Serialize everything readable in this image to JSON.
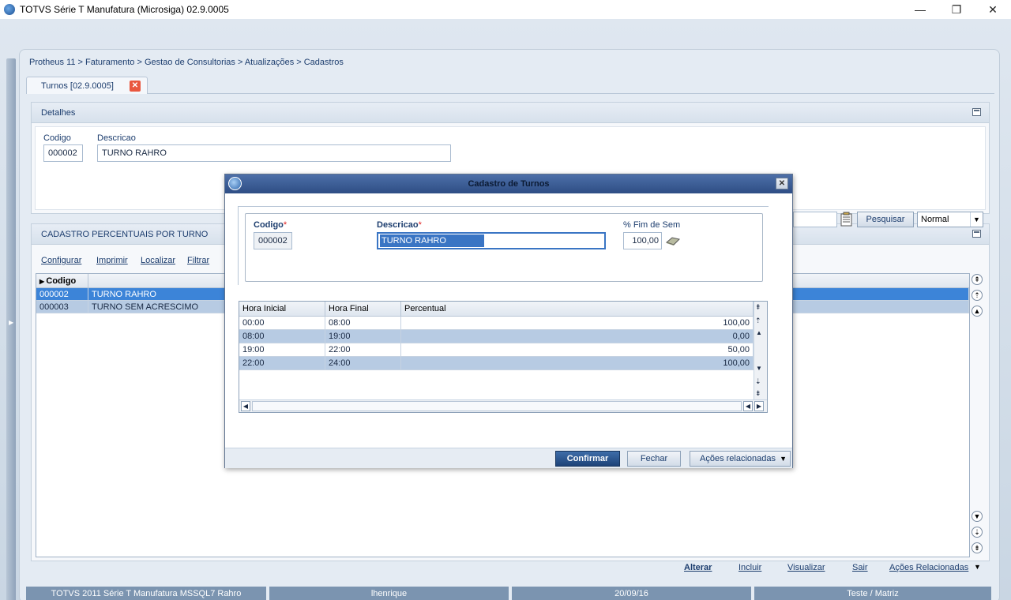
{
  "window": {
    "title": "TOTVS Série T Manufatura (Microsiga) 02.9.0005",
    "minimize": "—",
    "maximize": "❐",
    "close": "✕"
  },
  "breadcrumb": "Protheus 11 > Faturamento > Gestao de Consultorias > Atualizações > Cadastros",
  "tab": {
    "label": "Turnos [02.9.0005]",
    "close": "✕"
  },
  "details": {
    "title": "Detalhes",
    "codigo_label": "Codigo",
    "codigo_value": "000002",
    "descricao_label": "Descricao",
    "descricao_value": "TURNO RAHRO"
  },
  "cadastro": {
    "title": "CADASTRO PERCENTUAIS POR TURNO",
    "toolbar": [
      "Configurar",
      "Imprimir",
      "Localizar",
      "Filtrar"
    ],
    "pesquisar": "Pesquisar",
    "index_select": "Normal",
    "header_col": "Codigo",
    "rows": [
      {
        "codigo": "000002",
        "descricao": "TURNO RAHRO"
      },
      {
        "codigo": "000003",
        "descricao": "TURNO SEM ACRESCIMO"
      }
    ]
  },
  "bottom_actions": [
    "Alterar",
    "Incluir",
    "Visualizar",
    "Sair",
    "Ações Relacionadas"
  ],
  "status": [
    "TOTVS 2011 Série T Manufatura MSSQL7 Rahro",
    "lhenrique",
    "20/09/16",
    "Teste / Matriz"
  ],
  "modal": {
    "title": "Cadastro de Turnos",
    "codigo_label": "Codigo",
    "codigo_value": "000002",
    "descricao_label": "Descricao",
    "descricao_value": "TURNO RAHRO",
    "fim_sem_label": "% Fim de Sem",
    "fim_sem_value": "100,00",
    "required_mark": "*",
    "grid_headers": [
      "Hora Inicial",
      "Hora Final",
      "Percentual"
    ],
    "grid_rows": [
      {
        "hora_inicial": "00:00",
        "hora_final": "08:00",
        "percentual": "100,00"
      },
      {
        "hora_inicial": "08:00",
        "hora_final": "19:00",
        "percentual": "0,00"
      },
      {
        "hora_inicial": "19:00",
        "hora_final": "22:00",
        "percentual": "50,00"
      },
      {
        "hora_inicial": "22:00",
        "hora_final": "24:00",
        "percentual": "100,00"
      }
    ],
    "confirmar": "Confirmar",
    "fechar": "Fechar",
    "acoes": "Ações relacionadas"
  }
}
